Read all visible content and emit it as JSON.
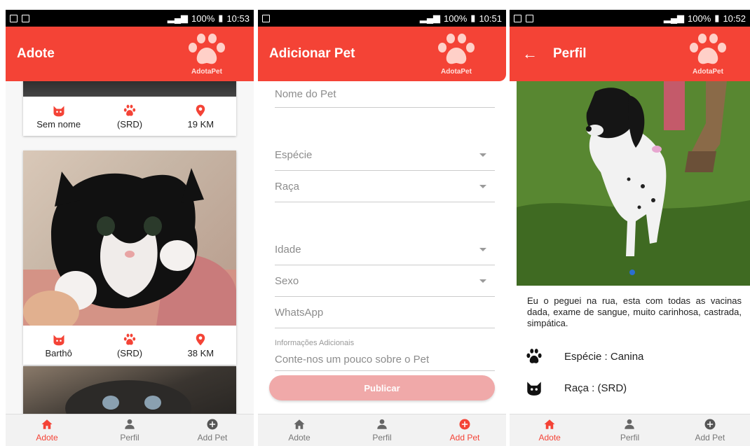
{
  "status_bars": [
    {
      "battery": "100%",
      "time": "10:53"
    },
    {
      "battery": "100%",
      "time": "10:51"
    },
    {
      "battery": "100%",
      "time": "10:52"
    }
  ],
  "screens": {
    "adote": {
      "title": "Adote",
      "logo_text": "AdotaPet",
      "cards": [
        {
          "name": "Sem nome",
          "breed": "(SRD)",
          "distance": "19 KM"
        },
        {
          "name": "Barthô",
          "breed": "(SRD)",
          "distance": "38 KM"
        }
      ]
    },
    "add_pet": {
      "title": "Adicionar Pet",
      "logo_text": "AdotaPet",
      "fields": {
        "name_placeholder": "Nome do Pet",
        "species_placeholder": "Espécie",
        "breed_placeholder": "Raça",
        "age_placeholder": "Idade",
        "sex_placeholder": "Sexo",
        "whatsapp_placeholder": "WhatsApp",
        "extra_label": "Informações Adicionais",
        "extra_placeholder": "Conte-nos um pouco sobre o Pet"
      },
      "publish_label": "Publicar"
    },
    "profile": {
      "title": "Perfil",
      "logo_text": "AdotaPet",
      "description": "Eu o peguei na rua, esta com todas as vacinas dada, exame de sangue, muito carinhosa, castrada, simpática.",
      "species": "Espécie : Canina",
      "breed": "Raça : (SRD)"
    }
  },
  "nav": {
    "adote": "Adote",
    "perfil": "Perfil",
    "add_pet": "Add Pet"
  },
  "colors": {
    "primary": "#f44336",
    "publish_disabled": "#f0a9a9"
  },
  "icons": [
    "back-arrow-icon",
    "paw-icon",
    "cat-icon",
    "location-pin-icon",
    "home-icon",
    "person-icon",
    "plus-circle-icon",
    "dropdown-caret-icon"
  ]
}
